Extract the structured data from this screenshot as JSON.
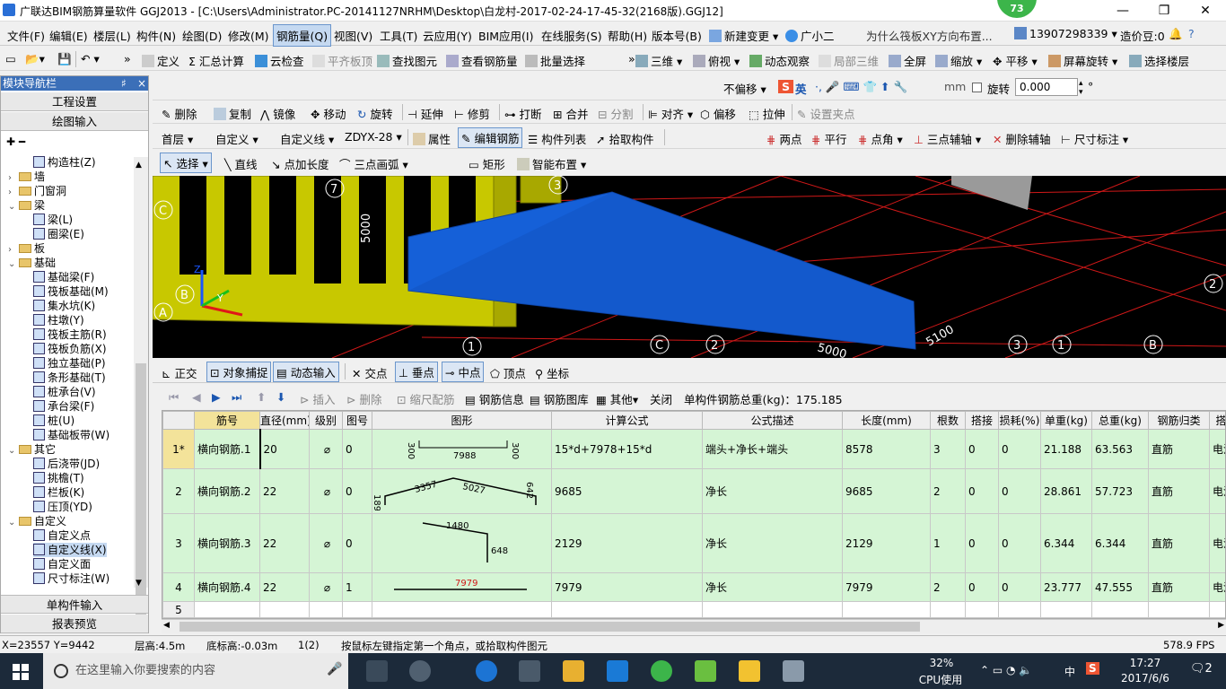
{
  "window": {
    "title": "广联达BIM钢筋算量软件 GGJ2013 - [C:\\Users\\Administrator.PC-20141127NRHM\\Desktop\\白龙村-2017-02-24-17-45-32(2168版).GGJ12]",
    "badge": "73",
    "min": "—",
    "max": "❐",
    "close": "✕"
  },
  "menu": {
    "items": [
      "文件(F)",
      "编辑(E)",
      "楼层(L)",
      "构件(N)",
      "绘图(D)",
      "修改(M)",
      "钢筋量(Q)",
      "视图(V)",
      "工具(T)",
      "云应用(Y)",
      "BIM应用(I)",
      "在线服务(S)",
      "帮助(H)",
      "版本号(B)",
      "新建变更",
      "广小二",
      "为什么筏板XY方向布置...",
      "13907298339",
      "造价豆:0"
    ]
  },
  "toolbar1": {
    "items": [
      "定义",
      "汇总计算",
      "云检查",
      "平齐板顶",
      "查找图元",
      "查看钢筋量",
      "批量选择",
      "三维",
      "俯视",
      "动态观察",
      "局部三维",
      "全屏",
      "缩放",
      "平移",
      "屏幕旋转",
      "选择楼层"
    ]
  },
  "toolbar2": {
    "items": [
      "删除",
      "复制",
      "镜像",
      "移动",
      "旋转",
      "延伸",
      "修剪",
      "打断",
      "合并",
      "分割",
      "对齐",
      "偏移",
      "拉伸",
      "设置夹点"
    ],
    "offset_select": "不偏移",
    "mm": "mm",
    "rotate": "旋转",
    "rotate_value": "0.000",
    "ime": "英"
  },
  "toolbar3": {
    "floor": "首层",
    "type": "自定义",
    "subtype": "自定义线",
    "code": "ZDYX-28",
    "items": [
      "属性",
      "编辑钢筋",
      "构件列表",
      "拾取构件",
      "两点",
      "平行",
      "点角",
      "三点辅轴",
      "删除辅轴",
      "尺寸标注"
    ]
  },
  "toolbar4": {
    "items": [
      "选择",
      "直线",
      "点加长度",
      "三点画弧",
      "矩形",
      "智能布置"
    ]
  },
  "nav": {
    "title": "模块导航栏",
    "pin": "♯",
    "close": "×",
    "top_buttons": [
      "工程设置",
      "绘图输入"
    ],
    "bottom_buttons": [
      "单构件输入",
      "报表预览"
    ],
    "tree": [
      {
        "label": "构造柱(Z)",
        "level": 2,
        "kind": "leaf"
      },
      {
        "label": "墙",
        "level": 1,
        "kind": "folder",
        "exp": "+"
      },
      {
        "label": "门窗洞",
        "level": 1,
        "kind": "folder",
        "exp": "+"
      },
      {
        "label": "梁",
        "level": 1,
        "kind": "folder",
        "exp": "-"
      },
      {
        "label": "梁(L)",
        "level": 2,
        "kind": "leaf"
      },
      {
        "label": "圈梁(E)",
        "level": 2,
        "kind": "leaf"
      },
      {
        "label": "板",
        "level": 1,
        "kind": "folder",
        "exp": "+"
      },
      {
        "label": "基础",
        "level": 1,
        "kind": "folder",
        "exp": "-"
      },
      {
        "label": "基础梁(F)",
        "level": 2,
        "kind": "leaf"
      },
      {
        "label": "筏板基础(M)",
        "level": 2,
        "kind": "leaf"
      },
      {
        "label": "集水坑(K)",
        "level": 2,
        "kind": "leaf"
      },
      {
        "label": "柱墩(Y)",
        "level": 2,
        "kind": "leaf"
      },
      {
        "label": "筏板主筋(R)",
        "level": 2,
        "kind": "leaf"
      },
      {
        "label": "筏板负筋(X)",
        "level": 2,
        "kind": "leaf"
      },
      {
        "label": "独立基础(P)",
        "level": 2,
        "kind": "leaf"
      },
      {
        "label": "条形基础(T)",
        "level": 2,
        "kind": "leaf"
      },
      {
        "label": "桩承台(V)",
        "level": 2,
        "kind": "leaf"
      },
      {
        "label": "承台梁(F)",
        "level": 2,
        "kind": "leaf"
      },
      {
        "label": "桩(U)",
        "level": 2,
        "kind": "leaf"
      },
      {
        "label": "基础板带(W)",
        "level": 2,
        "kind": "leaf"
      },
      {
        "label": "其它",
        "level": 1,
        "kind": "folder",
        "exp": "-"
      },
      {
        "label": "后浇带(JD)",
        "level": 2,
        "kind": "leaf"
      },
      {
        "label": "挑檐(T)",
        "level": 2,
        "kind": "leaf"
      },
      {
        "label": "栏板(K)",
        "level": 2,
        "kind": "leaf"
      },
      {
        "label": "压顶(YD)",
        "level": 2,
        "kind": "leaf"
      },
      {
        "label": "自定义",
        "level": 1,
        "kind": "folder",
        "exp": "-"
      },
      {
        "label": "自定义点",
        "level": 2,
        "kind": "leaf"
      },
      {
        "label": "自定义线(X)",
        "level": 2,
        "kind": "leaf",
        "selected": true
      },
      {
        "label": "自定义面",
        "level": 2,
        "kind": "leaf"
      },
      {
        "label": "尺寸标注(W)",
        "level": 2,
        "kind": "leaf"
      }
    ]
  },
  "viewport": {
    "labels": [
      "C",
      "B",
      "A",
      "7",
      "5000",
      "3",
      "1",
      "C",
      "2",
      "5100",
      "3",
      "1",
      "B",
      "2",
      "5000"
    ],
    "axes": {
      "z": "Z",
      "y": "Y"
    }
  },
  "snapbar": {
    "items": [
      "正交",
      "对象捕捉",
      "动态输入",
      "交点",
      "垂点",
      "中点",
      "顶点",
      "坐标"
    ]
  },
  "gridtoolbar": {
    "items": [
      "插入",
      "删除",
      "缩尺配筋",
      "钢筋信息",
      "钢筋图库",
      "其他",
      "关闭"
    ],
    "total": "单构件钢筋总重(kg)：175.185"
  },
  "table": {
    "headers": [
      "筋号",
      "直径(mm)",
      "级别",
      "图号",
      "图形",
      "计算公式",
      "公式描述",
      "长度(mm)",
      "根数",
      "搭接",
      "损耗(%)",
      "单重(kg)",
      "总重(kg)",
      "钢筋归类",
      "搭接形"
    ],
    "rows": [
      {
        "rn": "1*",
        "cells": [
          "横向钢筋.1",
          "20",
          "⌀",
          "0",
          "",
          "15*d+7978+15*d",
          "端头+净长+端头",
          "8578",
          "3",
          "0",
          "0",
          "21.188",
          "63.563",
          "直筋",
          "电渣压力"
        ],
        "fig": {
          "a": "300",
          "b": "7988",
          "c": "300"
        }
      },
      {
        "rn": "2",
        "cells": [
          "横向钢筋.2",
          "22",
          "⌀",
          "0",
          "",
          "9685",
          "净长",
          "9685",
          "2",
          "0",
          "0",
          "28.861",
          "57.723",
          "直筋",
          "电渣压力"
        ],
        "fig": {
          "a": "189",
          "b": "3357",
          "c": "5027",
          "d": "642"
        }
      },
      {
        "rn": "3",
        "cells": [
          "横向钢筋.3",
          "22",
          "⌀",
          "0",
          "",
          "2129",
          "净长",
          "2129",
          "1",
          "0",
          "0",
          "6.344",
          "6.344",
          "直筋",
          "电渣压力"
        ],
        "fig": {
          "a": "1480",
          "b": "648"
        }
      },
      {
        "rn": "4",
        "cells": [
          "横向钢筋.4",
          "22",
          "⌀",
          "1",
          "",
          "7979",
          "净长",
          "7979",
          "2",
          "0",
          "0",
          "23.777",
          "47.555",
          "直筋",
          "电渣压力"
        ],
        "fig": {
          "a": "7979"
        }
      },
      {
        "rn": "5",
        "cells": [
          "",
          "",
          "",
          "",
          "",
          "",
          "",
          "",
          "",
          "",
          "",
          "",
          "",
          "",
          ""
        ]
      }
    ]
  },
  "status": {
    "coords": "X=23557 Y=9442",
    "floor_h": "层高:4.5m",
    "bottom_h": "底标高:-0.03m",
    "count": "1(2)",
    "hint": "按鼠标左键指定第一个角点，或拾取构件图元",
    "fps": "578.9 FPS"
  },
  "taskbar": {
    "search": "在这里输入你要搜索的内容",
    "cpu": "32%",
    "cpu_label": "CPU使用",
    "lang": "中",
    "time": "17:27",
    "date": "2017/6/6",
    "notif": "2"
  },
  "colors": {
    "accent": "#3b6fb8",
    "viewport_bg": "#000000",
    "wall": "#c8c800",
    "slab": "#1560d8",
    "grid_green": "#d5f5d5"
  }
}
